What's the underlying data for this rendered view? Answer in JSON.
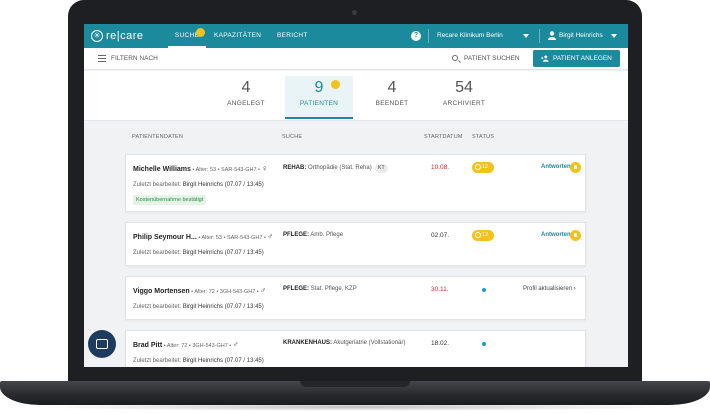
{
  "app": {
    "logo_glyph": "✳",
    "logo_text": "re|care",
    "nav_tabs": [
      {
        "label": "SUCHE",
        "active": true
      },
      {
        "label": "KAPAZITÄTEN",
        "active": false
      },
      {
        "label": "BERICHT",
        "active": false
      }
    ],
    "help_glyph": "?",
    "clinic": "Recare Klinikum Berlin",
    "user": "Birgit Heinrichs"
  },
  "filterbar": {
    "filter_label": "FILTERN NACH",
    "search_label": "PATIENT SUCHEN",
    "add_button": "PATIENT ANLEGEN"
  },
  "stats": [
    {
      "value": "4",
      "label": "ANGELEGT"
    },
    {
      "value": "9",
      "label": "PATIENTEN",
      "active": true
    },
    {
      "value": "4",
      "label": "BEENDET"
    },
    {
      "value": "54",
      "label": "ARCHIVIERT"
    }
  ],
  "table": {
    "headers": {
      "patient": "PATIENTENDATEN",
      "search": "SUCHE",
      "start": "STARTDATUM",
      "status": "STATUS"
    },
    "edited_prefix": "Zuletzt bearbeitet:",
    "rows": [
      {
        "name": "Michelle Williams",
        "meta": " • Alter: 53 • SAR-543-GH7 • ",
        "gender": "♀",
        "edited": "Birgit Heinrichs (07.07 / 13:45)",
        "tag": "Kostenübernahme bestätigt",
        "search_type": "REHAB:",
        "search_detail": " Orthopädie (Stat. Reha)",
        "chip": "KT",
        "date": "10.08.",
        "status_count": "12",
        "action": "Antworten ›"
      },
      {
        "name": "Philip Seymour H...",
        "meta": " • Alter: 53 • SAR-543-GH7 • ",
        "gender": "♂",
        "edited": "Birgit Heinrichs (07.07 / 13:45)",
        "search_type": "PFLEGE:",
        "search_detail": " Amb. Pflege",
        "date": "02.07.",
        "status_count": "12",
        "action": "Antworten ›"
      },
      {
        "name": "Viggo Mortensen",
        "meta": " • Alter: 72 • 3GH-543-GH7 • ",
        "gender": "♂",
        "edited": "Birgit Heinrichs (07.07 / 13:45)",
        "search_type": "PFLEGE:",
        "search_detail": " Stat. Pflege, KZP",
        "date": "30.11.",
        "action": "Profil aktualisieren ›"
      },
      {
        "name": "Brad Pitt",
        "meta": " • Alter: 72 • 3GH-543-GH7 • ",
        "gender": "♂",
        "edited": "Birgit Heinrichs (07.07 / 13:45)",
        "search_type": "KRANKENHAUS:",
        "search_detail": " Akutgeriatrie (Vollstationär)",
        "date": "18.02."
      }
    ]
  },
  "colors": {
    "brand": "#1b8a9c",
    "badge": "#f4c21a",
    "date_red": "#c62b2b",
    "chat": "#1d3a5f"
  }
}
